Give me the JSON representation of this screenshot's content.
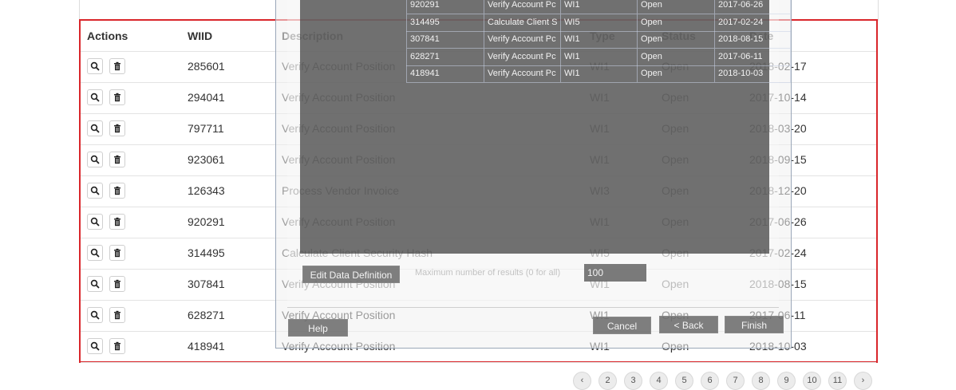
{
  "table": {
    "headers": {
      "actions": "Actions",
      "wiid": "WIID",
      "description": "Description",
      "type": "Type",
      "status": "Status",
      "date": "Date"
    },
    "rows": [
      {
        "wiid": "285601",
        "description": "Verify Account Position",
        "type": "WI1",
        "status": "Open",
        "date": "2018-02-17"
      },
      {
        "wiid": "294041",
        "description": "Verify Account Position",
        "type": "WI1",
        "status": "Open",
        "date": "2017-10-14"
      },
      {
        "wiid": "797711",
        "description": "Verify Account Position",
        "type": "WI1",
        "status": "Open",
        "date": "2018-03-20"
      },
      {
        "wiid": "923061",
        "description": "Verify Account Position",
        "type": "WI1",
        "status": "Open",
        "date": "2018-09-15"
      },
      {
        "wiid": "126343",
        "description": "Process Vendor Invoice",
        "type": "WI3",
        "status": "Open",
        "date": "2018-12-20"
      },
      {
        "wiid": "920291",
        "description": "Verify Account Position",
        "type": "WI1",
        "status": "Open",
        "date": "2017-06-26"
      },
      {
        "wiid": "314495",
        "description": "Calculate Client Security Hash",
        "type": "WI5",
        "status": "Open",
        "date": "2017-02-24"
      },
      {
        "wiid": "307841",
        "description": "Verify Account Position",
        "type": "WI1",
        "status": "Open",
        "date": "2018-08-15"
      },
      {
        "wiid": "628271",
        "description": "Verify Account Position",
        "type": "WI1",
        "status": "Open",
        "date": "2017-06-11"
      },
      {
        "wiid": "418941",
        "description": "Verify Account Position",
        "type": "WI1",
        "status": "Open",
        "date": "2018-10-03"
      }
    ]
  },
  "overlay": {
    "grid_rows": [
      {
        "wiid": "920291",
        "description": "Verify Account Pc",
        "type": "WI1",
        "status": "Open",
        "date": "2017-06-26"
      },
      {
        "wiid": "314495",
        "description": "Calculate Client S",
        "type": "WI5",
        "status": "Open",
        "date": "2017-02-24"
      },
      {
        "wiid": "307841",
        "description": "Verify Account Pc",
        "type": "WI1",
        "status": "Open",
        "date": "2018-08-15"
      },
      {
        "wiid": "628271",
        "description": "Verify Account Pc",
        "type": "WI1",
        "status": "Open",
        "date": "2017-06-11"
      },
      {
        "wiid": "418941",
        "description": "Verify Account Pc",
        "type": "WI1",
        "status": "Open",
        "date": "2018-10-03"
      }
    ],
    "edit_data_definition": "Edit Data Definition",
    "max_results_label": "Maximum number of results (0 for all)",
    "max_results_value": "100",
    "help": "Help",
    "cancel": "Cancel",
    "back": "< Back",
    "finish": "Finish"
  },
  "pager": {
    "prev": "‹",
    "pages": [
      "2",
      "3",
      "4",
      "5",
      "6",
      "7",
      "8",
      "9",
      "10",
      "11"
    ],
    "next": "›"
  },
  "colors": {
    "highlight_border": "#d9262b"
  }
}
